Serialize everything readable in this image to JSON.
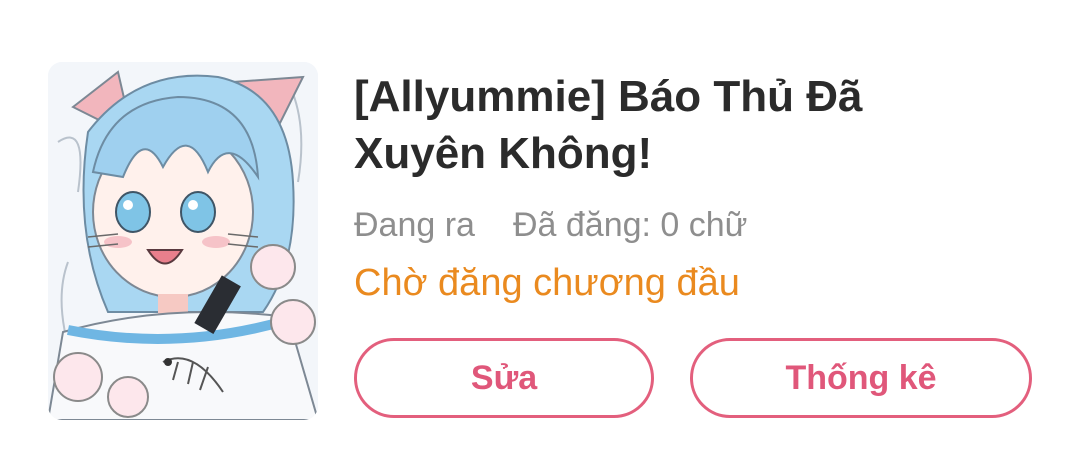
{
  "book": {
    "title": "[Allyummie] Báo Thủ Đã Xuyên Không!",
    "status": "Đang ra",
    "published": "Đã đăng: 0 chữ",
    "pending_note": "Chờ đăng chương đầu"
  },
  "actions": {
    "edit_label": "Sửa",
    "stats_label": "Thống kê"
  },
  "colors": {
    "accent_pink": "#e35f7d",
    "warning_orange": "#ea8a1f",
    "muted_gray": "#8e8e8e",
    "title_dark": "#2b2b2b"
  },
  "cover": {
    "icon": "anime-cat-girl-illustration"
  }
}
